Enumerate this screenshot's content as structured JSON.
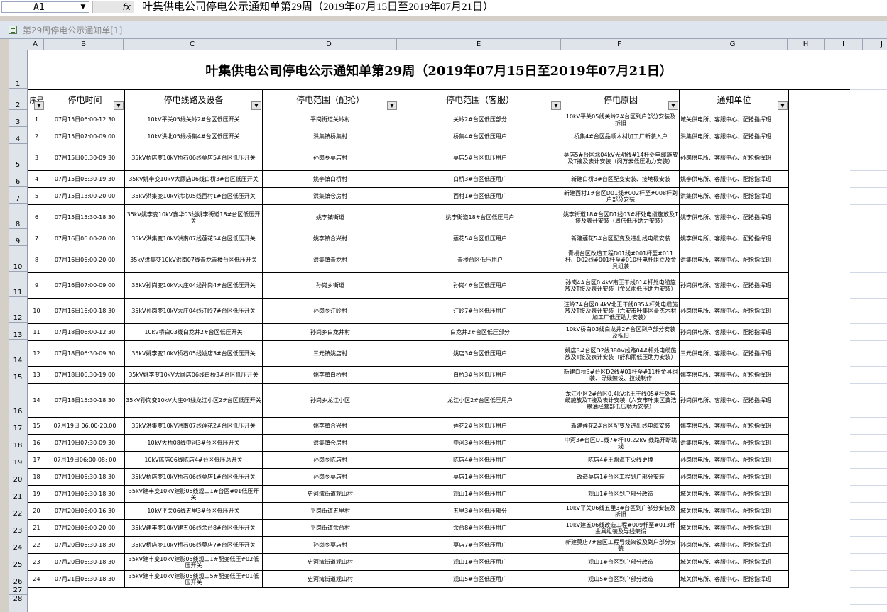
{
  "formula_bar": {
    "cell_ref": "A1",
    "fx_label": "fx",
    "content": "叶集供电公司停电公示通知单第29周（2019年07月15日至2019年07月21日）"
  },
  "window": {
    "title": "第29周停电公示通知单[1]"
  },
  "columns": [
    "A",
    "B",
    "C",
    "D",
    "E",
    "F",
    "G",
    "H",
    "I",
    "J"
  ],
  "rows": [
    "1",
    "2",
    "3",
    "4",
    "5",
    "6",
    "7",
    "8",
    "9",
    "10",
    "11",
    "12",
    "13",
    "14",
    "15",
    "16",
    "17",
    "18",
    "19",
    "20",
    "21",
    "22",
    "23",
    "24",
    "25",
    "26",
    "27",
    "28"
  ],
  "sheet": {
    "title": "叶集供电公司停电公示通知单第29周（2019年07月15日至2019年07月21日）",
    "headers": [
      "序号",
      "停电时间",
      "停电线路及设备",
      "停电范围（配抢）",
      "停电范围（客服）",
      "停电原因",
      "通知单位"
    ],
    "records": [
      [
        "1",
        "07月15日06:00-12:30",
        "10kV平关05线关岭2#台区低压开关",
        "平岗街道关岭村",
        "关岭2#台区低压部分",
        "10kV平关05线关岭2#台区到户部分安装及拆旧",
        "城关供电所、客服中心、配抢指挥班"
      ],
      [
        "2",
        "07月15日07:00-09:00",
        "10kV洪北05线桥集4#台区低压开关",
        "洪集镇桥集村",
        "桥集4#台区低压用户",
        "桥集4#台区品顺木材加工厂新装入户",
        "洪集供电所、客服中心、配抢指挥班"
      ],
      [
        "3",
        "07月15日06:30-09:30",
        "35kV桥店变10kV桥石06线莫店5#台区低压开关",
        "孙岗乡莫店村",
        "莫店5#台区低压用户",
        "莫店5#台区北04kV光明线#14杆处电缆施放及T接及表计安装（闵万云低压助力安装）",
        "孙岗供电所、客服中心、配抢指挥班"
      ],
      [
        "4",
        "07月15日06:30-19:30",
        "35kV姚李变10kV大顾店06线白桥3#台区低压开关",
        "姚李镇白桥村",
        "白桥3#台区低压用户",
        "新建白桥3#台区配变安装、接地极安装",
        "姚李供电所、客服中心、配抢指挥班"
      ],
      [
        "5",
        "07月15日13:00-20:00",
        "35kV洪集变10kV洪北05线西村1#台区低压开关",
        "洪集镇仓房村",
        "西村1#台区低压用户",
        "新建西村1#台区D01线#002杆至#008杆到户部分安装",
        "洪集供电所、客服中心、配抢指挥班"
      ],
      [
        "6",
        "07月15日15:30-18:30",
        "35kV姚李变10kV鑫华03线姚李街道18#台区低压开关",
        "姚李镇街道",
        "姚李街道18#台区低压用户",
        "姚李街道18#台区D1线03#杆处电缆施放及T接及表计安装（周伟低压助力安装）",
        "姚李供电所、客服中心、配抢指挥班"
      ],
      [
        "7",
        "07月16日06:00-20:00",
        "35kV洪集变10kV洪南07线莲花5#台区低压开关",
        "姚李镇合兴村",
        "莲花5#台区低压用户",
        "新建莲花5#台区配变及进出线电缆安装",
        "姚李供电所、客服中心、配抢指挥班"
      ],
      [
        "8",
        "07月16日06:00-20:00",
        "35kV洪集变10kV洪南07线青龙青楼台区低压开关",
        "洪集镇青龙村",
        "青楼台区低压用户",
        "青楼台区改造工程D01线#001杆至#011杆、D02线#001杆至#010杆电杆组立及金具组装",
        "洪集供电所、客服中心、配抢指挥班"
      ],
      [
        "9",
        "07月16日07:00-09:00",
        "35kV孙岗变10kV大庄04线孙岗4#台区低压开关",
        "孙岗乡街道",
        "孙岗4#台区低压用户",
        "孙岗4#台区0.4kV南王干线01#杆处电缆施放及T接及表计安装（金义雨低压助力安装）",
        "孙岗供电所、客服中心、配抢指挥班"
      ],
      [
        "10",
        "07月16日16:00-18:30",
        "35kV孙岗变10kV大庄04线汪岭7#台区低压开关",
        "孙岗乡汪岭村",
        "汪岭7#台区低压用户",
        "汪岭7#台区0.4kV北王干线035#杆处电缆施放及T接及表计安装（六安市叶集区豪杰木材加工厂低压助力安装）",
        "孙岗供电所、客服中心、配抢指挥班"
      ],
      [
        "11",
        "07月18日06:00-12:30",
        "10kV桥白03线白龙井2#台区低压开关",
        "孙岗乡白龙井村",
        "白龙井2#台区低压部分",
        "10kV桥白03线白龙井2#台区到户部分安装及拆旧",
        "孙岗供电所、客服中心、配抢指挥班"
      ],
      [
        "12",
        "07月18日06:30-09:30",
        "35kV姚李变10kV桥石05线姚店3#台区低压开关",
        "三元镇姚店村",
        "姚店3#台区低压用户",
        "姚店3#台区D2线380V线路04#杆处电缆施放及T接及表计安装（舒和雨低压助力安装）",
        "三元供电所、客服中心、配抢指挥班"
      ],
      [
        "13",
        "07月18日06:30-19:00",
        "35kV姚李变10kV大顾店06线白桥3#台区低压开关",
        "姚李镇白桥村",
        "白桥3#台区低压用户",
        "新建白桥3#台区D2线#01杆至#11杆金具组装、导线架设、拉线制作",
        "姚李供电所、客服中心、配抢指挥班"
      ],
      [
        "14",
        "07月18日15:30-18:30",
        "35kV孙岗变10kV大庄04线龙江小区2#台区低压开关",
        "孙岗乡龙江小区",
        "龙江小区2#台区低压用户",
        "龙江小区2#台区0.4kV北王干线05#杆处电缆施放及T接及表计安装（六安市叶集区黄浩粮油经营部低压助力安装）",
        "孙岗供电所、客服中心、配抢指挥班"
      ],
      [
        "15",
        "07月19日 06:00-20:00",
        "35kV洪集变10kV洪南07线莲花2#台区低压开关",
        "姚李镇合兴村",
        "莲花2#台区低压用户",
        "新建莲花2#台区配变及进出线电缆安装",
        "姚李供电所、客服中心、配抢指挥班"
      ],
      [
        "16",
        "07月19日07:30-09:30",
        "10kV大桥08线中河3#台区低压开关",
        "洪集镇仓房村",
        "中河3#台区低压用户",
        "中河3#台区D1线7#杆T0.22kV 线路开断跳线",
        "洪集供电所、客服中心、配抢指挥班"
      ],
      [
        "17",
        "07月19日06:00-08: 00",
        "10kV陈店06线陈店4#台区低压总开关",
        "孙岗乡陈店村",
        "陈店4#台区低压用户",
        "陈店4#王照海下火线更换",
        "孙岗供电所、客服中心、配抢指挥班"
      ],
      [
        "18",
        "07月19日06:30-18:30",
        "35kV桥店变10kV桥石06线莫店1#台区低压开关",
        "孙岗乡莫店村",
        "莫店1#台区低压用户",
        "改造莫店1#台区工程到户部分安装",
        "孙岗供电所、客服中心、配抢指挥班"
      ],
      [
        "19",
        "07月19日06:30-18:30",
        "35kV建丰变10kV建影05线观山1#台区#01低压开关",
        "史河湾街道观山村",
        "观山1#台区低压用户",
        "观山1#台区到户部分改造",
        "城关供电所、客服中心、配抢指挥班"
      ],
      [
        "20",
        "07月20日06:00-16:30",
        "10kV平关06线五里3#台区低压开关",
        "平岗街道五里村",
        "五里3#台区低压部分",
        "10kV平关06线五里3#台区到户部分安装及拆旧",
        "城关供电所、客服中心、配抢指挥班"
      ],
      [
        "21",
        "07月20日06:00-20:00",
        "35kV建丰变10kV建五06线余台8#台区低压开关",
        "平岗街道余台村",
        "余台8#台区低压用户",
        "10kV建五06线改造工程#009杆至#013杆金具组装及导线架设",
        "城关供电所、客服中心、配抢指挥班"
      ],
      [
        "22",
        "07月20日06:30-18:30",
        "35kV桥店变10kV桥石06线莫店7#台区低压开关",
        "孙岗乡莫店村",
        "莫店7#台区低压用户",
        "新建莫店7#台区工程导线架设及到户部分安装",
        "孙岗供电所、客服中心、配抢指挥班"
      ],
      [
        "23",
        "07月20日06:30-18:30",
        "35kV建丰变10kV建影05线观山1#配变低压#02低压开关",
        "史河湾街道观山村",
        "观山1#台区低压用户",
        "观山1#台区到户部分改造",
        "城关供电所、客服中心、配抢指挥班"
      ],
      [
        "24",
        "07月21日06:30-18:30",
        "35kV建丰变10kV建影05线观山5#配变低压#01低压开关",
        "史河湾街道观山村",
        "观山5#台区低压用户",
        "观山5#台区到户部分改造",
        "城关供电所、客服中心、配抢指挥班"
      ]
    ]
  }
}
